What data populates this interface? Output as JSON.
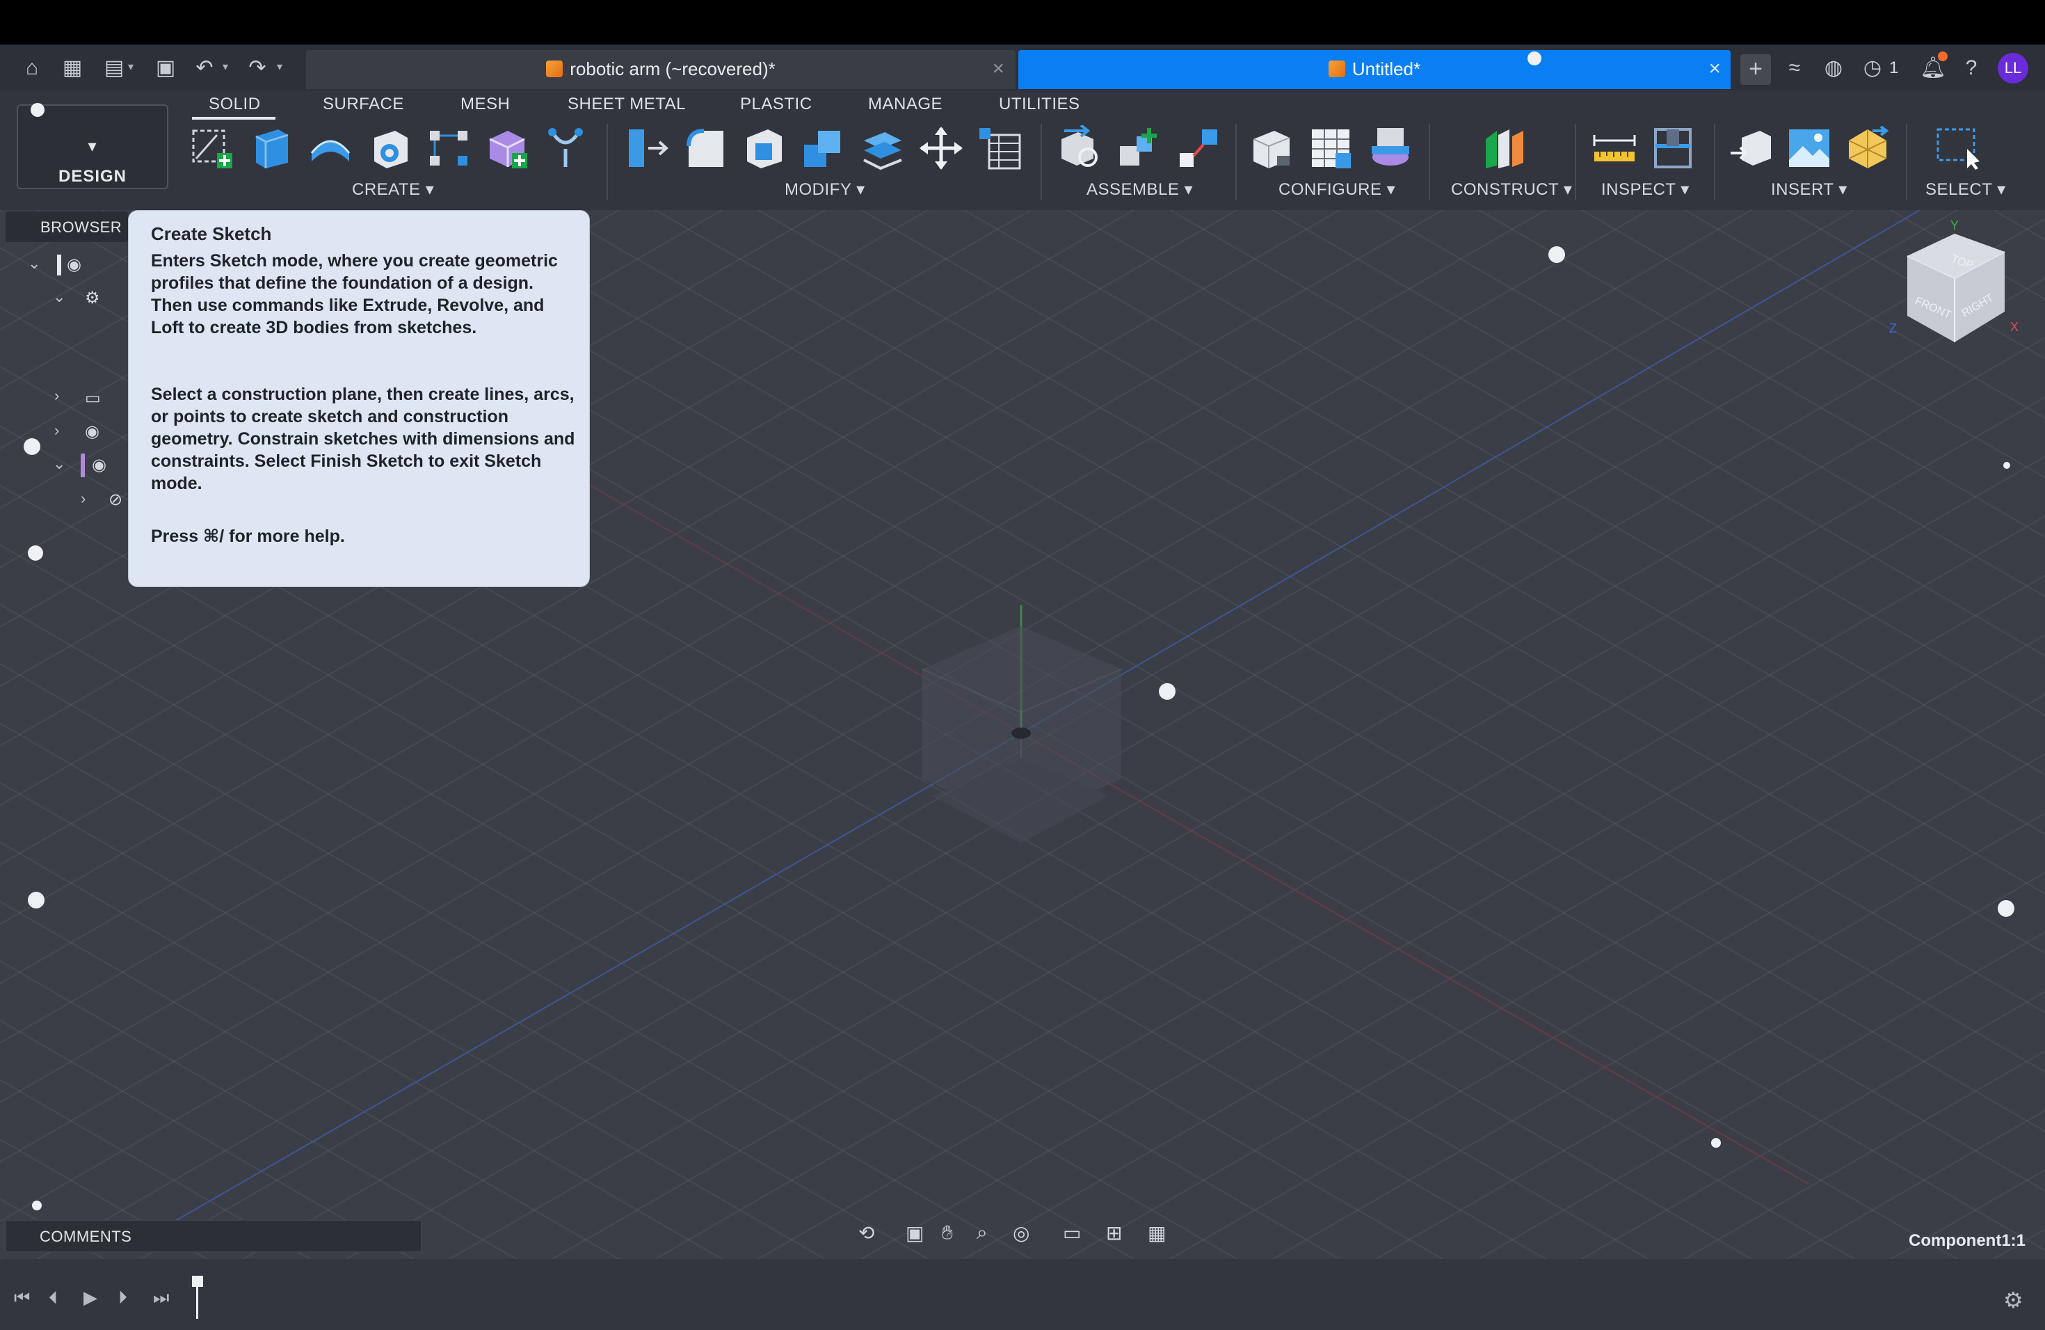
{
  "window": {
    "tabs": [
      {
        "label": "robotic arm (~recovered)*",
        "active": false
      },
      {
        "label": "Untitled*",
        "active": true
      }
    ],
    "job_count": "1",
    "user_initials": "LL"
  },
  "workspace": {
    "label": "DESIGN",
    "tabs": [
      "SOLID",
      "SURFACE",
      "MESH",
      "SHEET METAL",
      "PLASTIC",
      "MANAGE",
      "UTILITIES"
    ],
    "active_tab": "SOLID"
  },
  "toolbar": {
    "groups": [
      "CREATE",
      "MODIFY",
      "ASSEMBLE",
      "CONFIGURE",
      "CONSTRUCT",
      "INSPECT",
      "INSERT",
      "SELECT"
    ]
  },
  "browser": {
    "label": "BROWSER"
  },
  "tooltip": {
    "title": "Create Sketch",
    "para1": "Enters Sketch mode, where you create geometric profiles that define the foundation of a design. Then use commands like Extrude, Revolve, and Loft to create 3D bodies from sketches.",
    "para2": "Select a construction plane, then create lines, arcs, or points to create sketch and construction geometry. Constrain sketches with dimensions and constraints. Select Finish Sketch to exit Sketch mode.",
    "para3": "Press ⌘/ for more help."
  },
  "viewcube": {
    "top": "TOP",
    "front": "FRONT",
    "right": "RIGHT",
    "axis_y": "Y",
    "axis_x": "X",
    "axis_z": "Z"
  },
  "comments": {
    "label": "COMMENTS"
  },
  "status": {
    "component": "Component1:1"
  },
  "colors": {
    "accent_tab": "#0a7ef3",
    "avatar": "#6a2bd9",
    "notify": "#f56b2a"
  }
}
